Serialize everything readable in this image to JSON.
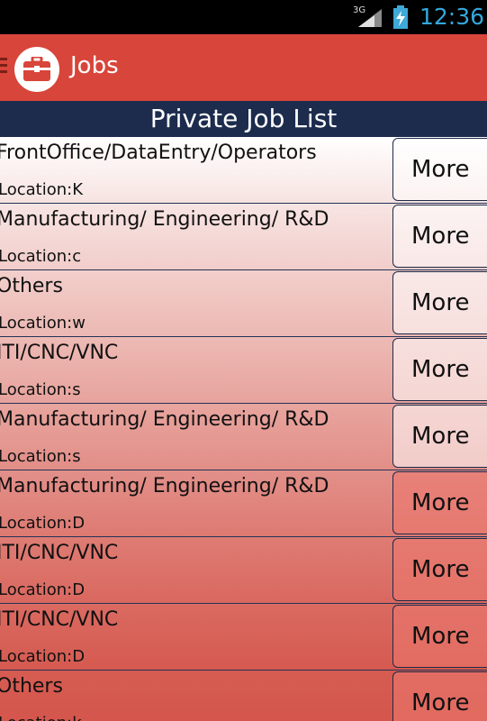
{
  "status_bar": {
    "network": "3G",
    "time": "12:36"
  },
  "action_bar": {
    "title": "Jobs"
  },
  "list": {
    "header": "Private Job List",
    "more_label": "More",
    "jobs": [
      {
        "category": "FrontOffice/DataEntry/Operators",
        "location": "Location:K"
      },
      {
        "category": "Manufacturing/ Engineering/ R&D",
        "location": "Location:c"
      },
      {
        "category": "Others",
        "location": "Location:w"
      },
      {
        "category": "ITI/CNC/VNC",
        "location": "Location:s"
      },
      {
        "category": "Manufacturing/ Engineering/ R&D",
        "location": "Location:s"
      },
      {
        "category": "Manufacturing/ Engineering/ R&D",
        "location": "Location:D"
      },
      {
        "category": "ITI/CNC/VNC",
        "location": "Location:D"
      },
      {
        "category": "ITI/CNC/VNC",
        "location": "Location:D"
      },
      {
        "category": "Others",
        "location": "Location:k"
      }
    ]
  },
  "colors": {
    "action_bar": "#d8453a",
    "header": "#1d2c4d",
    "clock": "#34a8dc"
  }
}
